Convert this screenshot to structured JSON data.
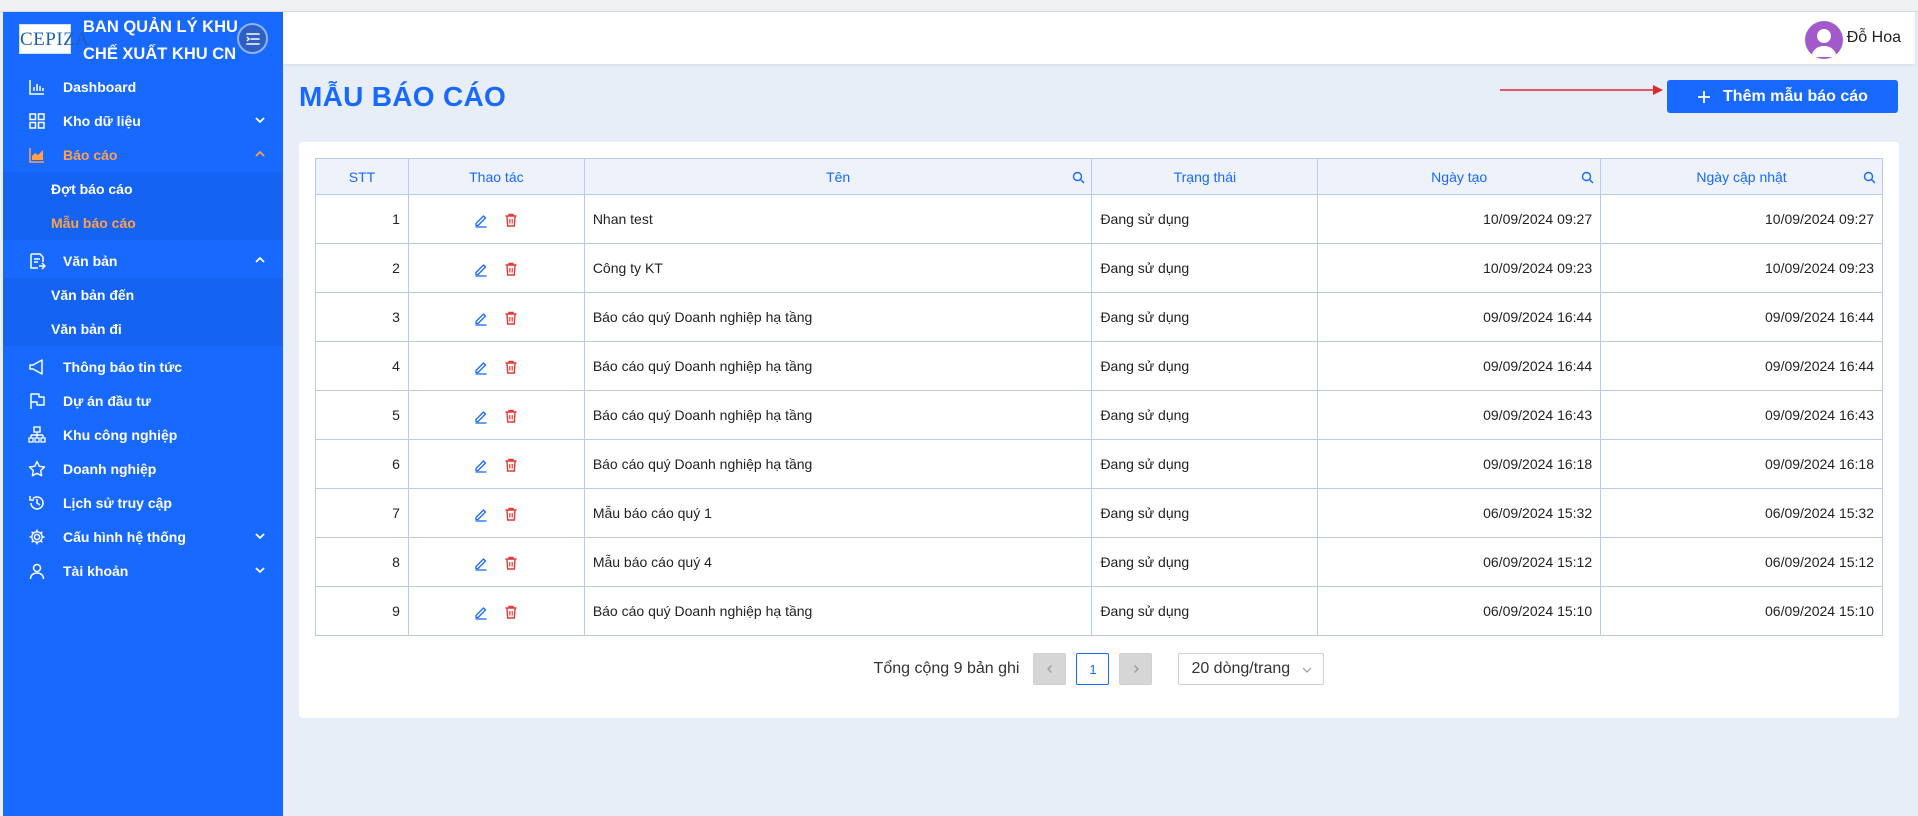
{
  "brand": {
    "logo_text": "CEPIZA",
    "name_line1": "BAN QUẢN LÝ KHU",
    "name_line2": "CHẾ XUẤT KHU CN"
  },
  "sidebar": {
    "items": [
      {
        "label": "Dashboard",
        "icon": "bar-chart-icon"
      },
      {
        "label": "Kho dữ liệu",
        "icon": "grid-icon"
      },
      {
        "label": "Báo cáo",
        "icon": "area-chart-icon"
      },
      {
        "label": "Văn bản",
        "icon": "document-send-icon"
      },
      {
        "label": "Thông báo tin tức",
        "icon": "megaphone-icon"
      },
      {
        "label": "Dự án đầu tư",
        "icon": "flag-icon"
      },
      {
        "label": "Khu công nghiệp",
        "icon": "hierarchy-icon"
      },
      {
        "label": "Doanh nghiệp",
        "icon": "star-icon"
      },
      {
        "label": "Lịch sử truy cập",
        "icon": "history-icon"
      },
      {
        "label": "Cấu hình hệ thống",
        "icon": "gear-icon"
      },
      {
        "label": "Tài khoản",
        "icon": "user-icon"
      }
    ],
    "bao_cao_sub": [
      "Đợt báo cáo",
      "Mẫu báo cáo"
    ],
    "van_ban_sub": [
      "Văn bản đến",
      "Văn bản đi"
    ]
  },
  "header": {
    "user_name": "Đỗ Hoa"
  },
  "page": {
    "title": "MẪU BÁO CÁO",
    "add_button": "Thêm mẫu báo cáo"
  },
  "table": {
    "columns": [
      "STT",
      "Thao tác",
      "Tên",
      "Trạng thái",
      "Ngày tạo",
      "Ngày cập nhật"
    ],
    "rows": [
      {
        "stt": "1",
        "name": "Nhan test",
        "status": "Đang sử dụng",
        "created": "10/09/2024 09:27",
        "updated": "10/09/2024 09:27"
      },
      {
        "stt": "2",
        "name": "Công ty KT",
        "status": "Đang sử dụng",
        "created": "10/09/2024 09:23",
        "updated": "10/09/2024 09:23"
      },
      {
        "stt": "3",
        "name": "Báo cáo quý Doanh nghiệp hạ tầng",
        "status": "Đang sử dụng",
        "created": "09/09/2024 16:44",
        "updated": "09/09/2024 16:44"
      },
      {
        "stt": "4",
        "name": "Báo cáo quý Doanh nghiệp hạ tầng",
        "status": "Đang sử dụng",
        "created": "09/09/2024 16:44",
        "updated": "09/09/2024 16:44"
      },
      {
        "stt": "5",
        "name": "Báo cáo quý Doanh nghiệp hạ tầng",
        "status": "Đang sử dụng",
        "created": "09/09/2024 16:43",
        "updated": "09/09/2024 16:43"
      },
      {
        "stt": "6",
        "name": "Báo cáo quý Doanh nghiệp hạ tầng",
        "status": "Đang sử dụng",
        "created": "09/09/2024 16:18",
        "updated": "09/09/2024 16:18"
      },
      {
        "stt": "7",
        "name": "Mẫu báo cáo quý 1",
        "status": "Đang sử dụng",
        "created": "06/09/2024 15:32",
        "updated": "06/09/2024 15:32"
      },
      {
        "stt": "8",
        "name": "Mẫu báo cáo quý 4",
        "status": "Đang sử dụng",
        "created": "06/09/2024 15:12",
        "updated": "06/09/2024 15:12"
      },
      {
        "stt": "9",
        "name": "Báo cáo quý Doanh nghiệp hạ tầng",
        "status": "Đang sử dụng",
        "created": "06/09/2024 15:10",
        "updated": "06/09/2024 15:10"
      }
    ]
  },
  "pagination": {
    "total": "Tổng cộng 9 bản ghi",
    "current_page": "1",
    "page_size": "20 dòng/trang"
  },
  "colors": {
    "primary": "#1769ff",
    "active_menu": "#ffa14a",
    "status": "#e09b2a",
    "delete": "#e53935",
    "annotation_arrow": "#e0282e"
  }
}
